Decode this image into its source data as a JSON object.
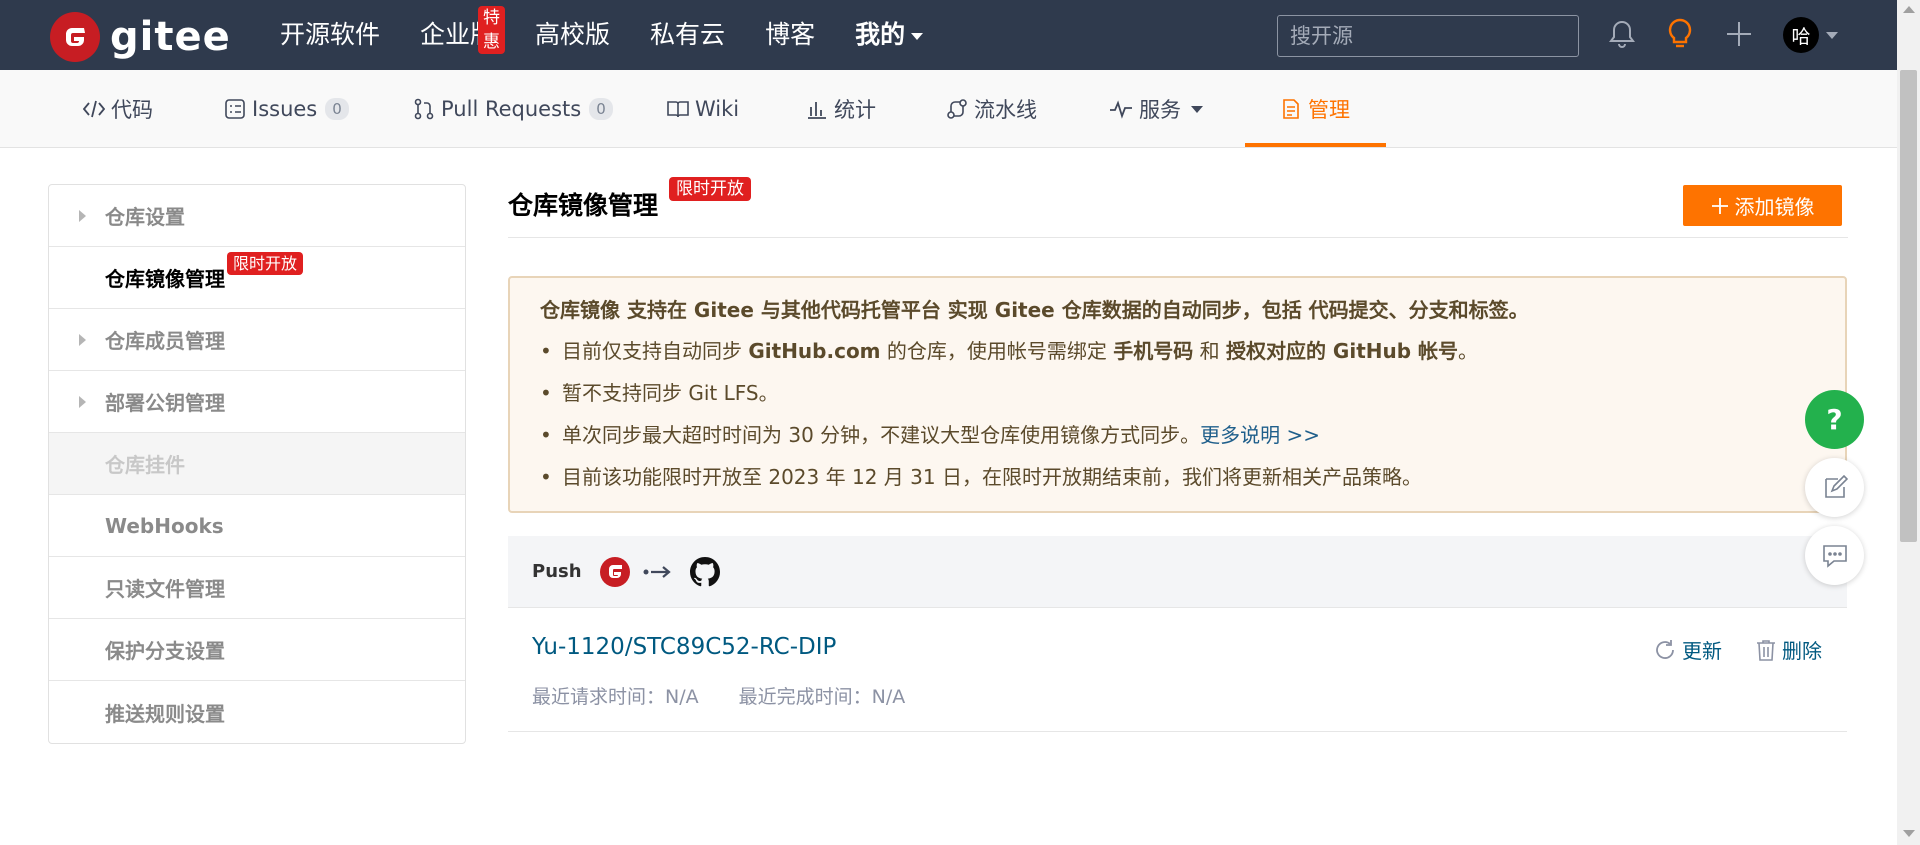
{
  "brand": {
    "name": "gitee",
    "color": "#c71d23"
  },
  "topnav": {
    "items": [
      "开源软件",
      "企业版",
      "高校版",
      "私有云",
      "博客"
    ],
    "hot_badge": "特惠",
    "mine_label": "我的"
  },
  "search": {
    "placeholder": "搜开源"
  },
  "user": {
    "avatar_text": "哈"
  },
  "repo_tabs": {
    "code": "代码",
    "issues": "Issues",
    "issues_count": "0",
    "pulls": "Pull Requests",
    "pulls_count": "0",
    "wiki": "Wiki",
    "stats": "统计",
    "pipeline": "流水线",
    "services": "服务",
    "manage": "管理"
  },
  "sidebar": {
    "items": [
      {
        "label": "仓库设置"
      },
      {
        "label": "仓库镜像管理",
        "badge": "限时开放"
      },
      {
        "label": "仓库成员管理"
      },
      {
        "label": "部署公钥管理"
      },
      {
        "label": "仓库挂件"
      },
      {
        "label": "WebHooks"
      },
      {
        "label": "只读文件管理"
      },
      {
        "label": "保护分支设置"
      },
      {
        "label": "推送规则设置"
      }
    ]
  },
  "main": {
    "title": "仓库镜像管理",
    "title_badge": "限时开放",
    "add_button": "添加镜像"
  },
  "notice": {
    "head": "仓库镜像 支持在 Gitee 与其他代码托管平台 实现 Gitee 仓库数据的自动同步，包括 代码提交、分支和标签。",
    "l1_a": "目前仅支持自动同步 ",
    "l1_b": "GitHub.com",
    "l1_c": " 的仓库，使用帐号需绑定 ",
    "l1_d": "手机号码",
    "l1_e": " 和 ",
    "l1_f": "授权对应的 GitHub 帐号",
    "l1_g": "。",
    "l2": "暂不支持同步 Git LFS。",
    "l3": "单次同步最大超时时间为 30 分钟，不建议大型仓库使用镜像方式同步。",
    "l3_link": "更多说明 >>",
    "l4": "目前该功能限时开放至 2023 年 12 月 31 日，在限时开放期结束前，我们将更新相关产品策略。"
  },
  "mirror": {
    "direction": "Push",
    "repo": "Yu-1120/STC89C52-RC-DIP",
    "last_request": "最近请求时间：N/A",
    "last_complete": "最近完成时间：N/A",
    "update": "更新",
    "delete": "删除"
  },
  "float": {
    "help": "?"
  },
  "colors": {
    "accent": "#fe7300",
    "topbar": "#2f3a4d",
    "link": "#005980",
    "badge": "#e02020",
    "help": "#23b14d"
  }
}
